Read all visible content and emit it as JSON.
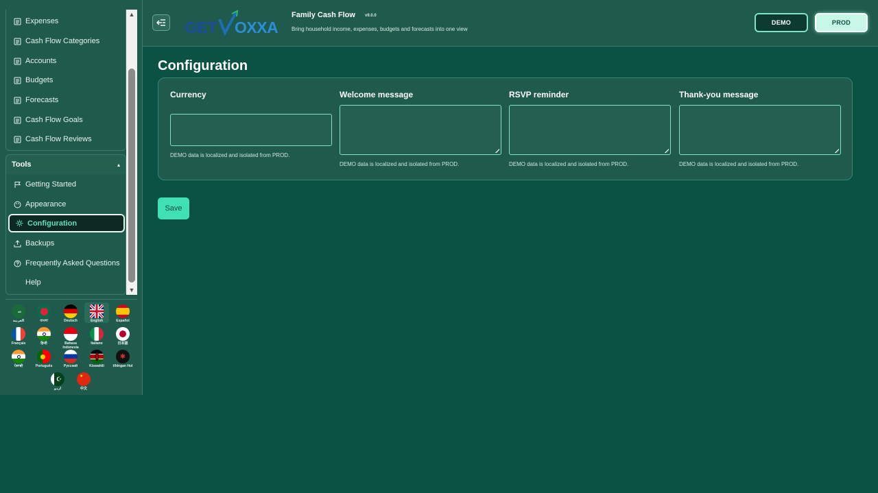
{
  "sidebar": {
    "nav_items": [
      {
        "label": "Expenses",
        "icon": "list-icon"
      },
      {
        "label": "Cash Flow Categories",
        "icon": "list-icon"
      },
      {
        "label": "Accounts",
        "icon": "list-icon"
      },
      {
        "label": "Budgets",
        "icon": "list-icon"
      },
      {
        "label": "Forecasts",
        "icon": "list-icon"
      },
      {
        "label": "Cash Flow Goals",
        "icon": "list-icon"
      },
      {
        "label": "Cash Flow Reviews",
        "icon": "list-icon"
      }
    ],
    "tools": {
      "title": "Tools",
      "toggle": "▴",
      "items": [
        {
          "label": "Getting Started",
          "icon": "flag-icon"
        },
        {
          "label": "Appearance",
          "icon": "palette-icon"
        },
        {
          "label": "Configuration",
          "icon": "gear-icon",
          "active": true
        },
        {
          "label": "Backups",
          "icon": "upload-icon"
        },
        {
          "label": "Frequently Asked Questions",
          "icon": "help-circle-icon"
        },
        {
          "label": "Help",
          "icon": ""
        }
      ]
    },
    "languages": [
      {
        "name": "العربية",
        "flag": "saudi-arabia"
      },
      {
        "name": "বাংলা",
        "flag": "bangladesh"
      },
      {
        "name": "Deutsch",
        "flag": "germany"
      },
      {
        "name": "English",
        "flag": "united-kingdom",
        "selected": true
      },
      {
        "name": "Español",
        "flag": "spain"
      },
      {
        "name": "Français",
        "flag": "france"
      },
      {
        "name": "हिन्दी",
        "flag": "india"
      },
      {
        "name": "Bahasa Indonesia",
        "flag": "indonesia"
      },
      {
        "name": "Italiano",
        "flag": "italy"
      },
      {
        "name": "日本語",
        "flag": "japan"
      },
      {
        "name": "ਪੰਜਾਬੀ",
        "flag": "india"
      },
      {
        "name": "Português",
        "flag": "portugal"
      },
      {
        "name": "Русский",
        "flag": "russia"
      },
      {
        "name": "Kiswahili",
        "flag": "kenya"
      },
      {
        "name": "tlhIngan Hol",
        "flag": "klingon"
      },
      {
        "name": "اردو",
        "flag": "pakistan"
      },
      {
        "name": "中文",
        "flag": "china"
      }
    ]
  },
  "header": {
    "logo_text": "GETVOXXA",
    "title": "Family Cash Flow",
    "version": "v9.0.0",
    "subtitle": "Bring household income, expenses, budgets and forecasts into one view",
    "demo_label": "DEMO",
    "prod_label": "PROD",
    "active_env": "PROD"
  },
  "main": {
    "page_title": "Configuration",
    "fields": [
      {
        "label": "Currency",
        "value": "",
        "type": "input",
        "hint": "DEMO data is localized and isolated from PROD."
      },
      {
        "label": "Welcome message",
        "value": "",
        "type": "textarea",
        "hint": "DEMO data is localized and isolated from PROD."
      },
      {
        "label": "RSVP reminder",
        "value": "",
        "type": "textarea",
        "hint": "DEMO data is localized and isolated from PROD."
      },
      {
        "label": "Thank-you message",
        "value": "",
        "type": "textarea",
        "hint": "DEMO data is localized and isolated from PROD."
      }
    ],
    "save_label": "Save"
  },
  "colors": {
    "background": "#0a5244",
    "panel": "#1f5a4d",
    "accent": "#3ee0b4",
    "border": "#7fe3c6"
  }
}
